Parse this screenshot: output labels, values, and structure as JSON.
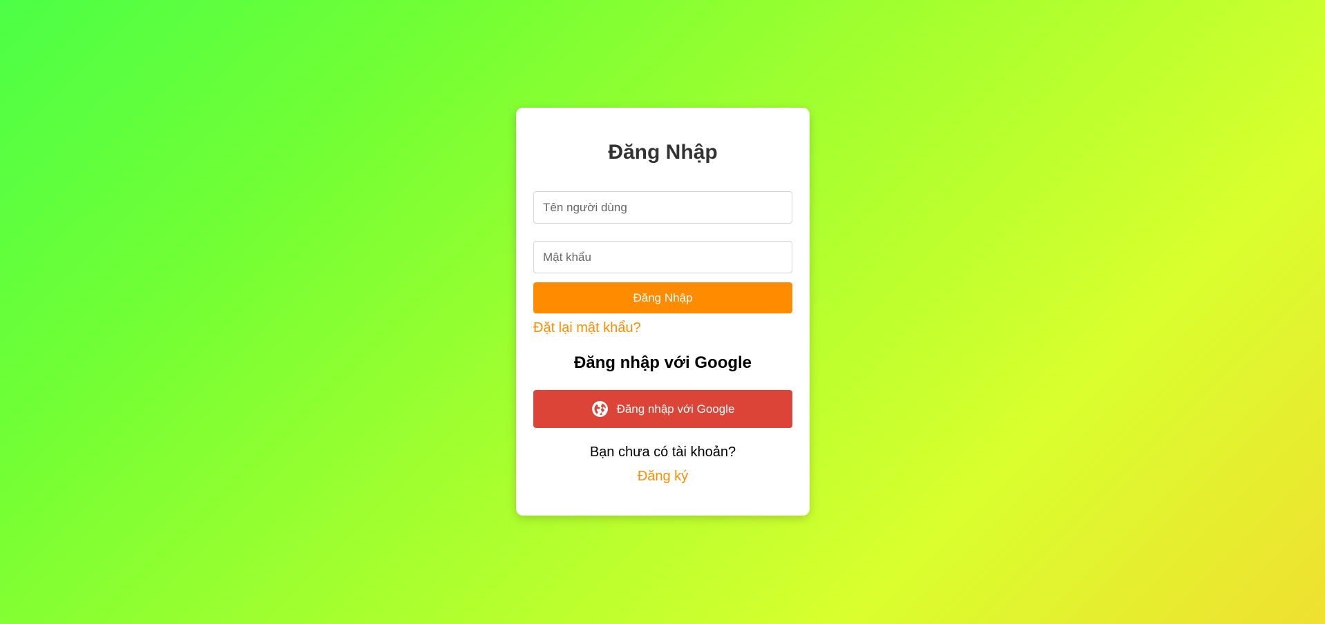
{
  "login_form": {
    "title": "Đăng Nhập",
    "username_placeholder": "Tên người dùng",
    "password_placeholder": "Mật khẩu",
    "username_value": "",
    "password_value": "",
    "submit_label": "Đăng Nhập",
    "forgot_password_label": "Đặt lại mật khẩu?"
  },
  "google_section": {
    "heading": "Đăng nhập với Google",
    "button_label": "Đăng nhập với Google",
    "button_icon": "globe-icon"
  },
  "register_section": {
    "prompt": "Bạn chưa có tài khoản?",
    "link_label": "Đăng ký"
  },
  "colors": {
    "accent": "#ff8c00",
    "google_button": "#db4437",
    "card_background": "#ffffff",
    "title_text": "#333333"
  }
}
